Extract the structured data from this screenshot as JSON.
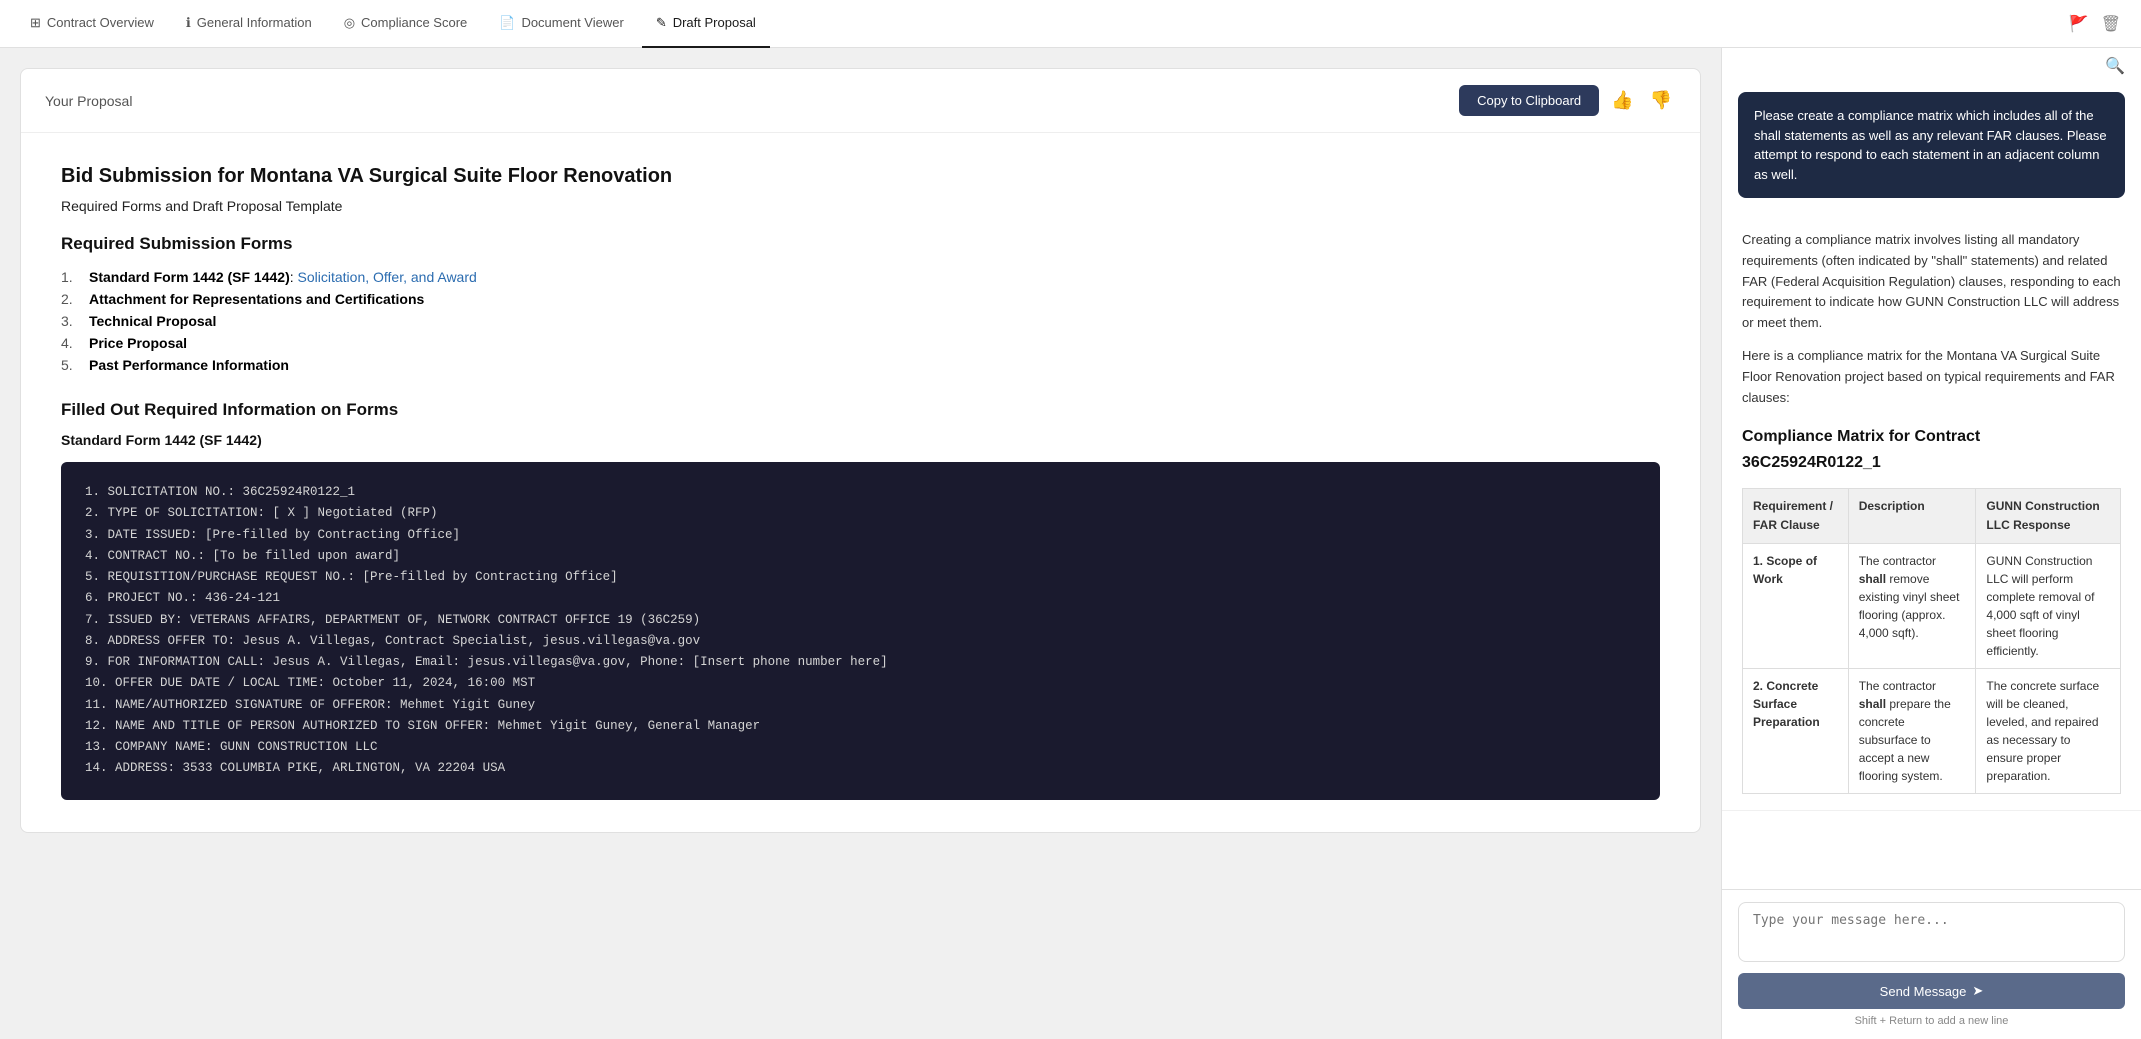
{
  "nav": {
    "tabs": [
      {
        "id": "contract-overview",
        "label": "Contract Overview",
        "icon": "⊞",
        "active": false
      },
      {
        "id": "general-information",
        "label": "General Information",
        "icon": "ℹ",
        "active": false
      },
      {
        "id": "compliance-score",
        "label": "Compliance Score",
        "icon": "◎",
        "active": false
      },
      {
        "id": "document-viewer",
        "label": "Document Viewer",
        "icon": "📄",
        "active": false
      },
      {
        "id": "draft-proposal",
        "label": "Draft Proposal",
        "icon": "✎",
        "active": true
      }
    ],
    "delete_icon": "🗑",
    "trash_icon": "🗑"
  },
  "proposal": {
    "label": "Your Proposal",
    "copy_button": "Copy to Clipboard",
    "title": "Bid Submission for Montana VA Surgical Suite Floor Renovation",
    "subtitle": "Required Forms and Draft Proposal Template",
    "required_submission_title": "Required Submission Forms",
    "forms_list": [
      {
        "num": "1.",
        "bold": "Standard Form 1442 (SF 1442)",
        "separator": ": ",
        "link": "Solicitation, Offer, and Award"
      },
      {
        "num": "2.",
        "bold": "Attachment for Representations and Certifications",
        "separator": "",
        "link": ""
      },
      {
        "num": "3.",
        "bold": "Technical Proposal",
        "separator": "",
        "link": ""
      },
      {
        "num": "4.",
        "bold": "Price Proposal",
        "separator": "",
        "link": ""
      },
      {
        "num": "5.",
        "bold": "Past Performance Information",
        "separator": "",
        "link": ""
      }
    ],
    "filled_section_title": "Filled Out Required Information on Forms",
    "sf1442_title": "Standard Form 1442 (SF 1442)",
    "code_lines": [
      "1.  SOLICITATION NO.: 36C25924R0122_1",
      "2.  TYPE OF SOLICITATION: [ X ] Negotiated (RFP)",
      "3.  DATE ISSUED: [Pre-filled by Contracting Office]",
      "4.  CONTRACT NO.: [To be filled upon award]",
      "5.  REQUISITION/PURCHASE REQUEST NO.: [Pre-filled by Contracting Office]",
      "6.  PROJECT NO.: 436-24-121",
      "7.  ISSUED BY: VETERANS AFFAIRS, DEPARTMENT OF, NETWORK CONTRACT OFFICE 19 (36C259)",
      "8.  ADDRESS OFFER TO: Jesus A. Villegas, Contract Specialist, jesus.villegas@va.gov",
      "9.  FOR INFORMATION CALL: Jesus A. Villegas, Email: jesus.villegas@va.gov, Phone: [Insert phone number here]",
      "10. OFFER DUE DATE / LOCAL TIME: October 11, 2024, 16:00 MST",
      "11. NAME/AUTHORIZED SIGNATURE OF OFFEROR: Mehmet Yigit Guney",
      "12. NAME AND TITLE OF PERSON AUTHORIZED TO SIGN OFFER: Mehmet Yigit Guney, General Manager",
      "13. COMPANY NAME: GUNN CONSTRUCTION LLC",
      "14. ADDRESS: 3533 COLUMBIA PIKE, ARLINGTON, VA 22204 USA"
    ]
  },
  "chat": {
    "tooltip": "Please create a compliance matrix which includes all of the shall statements as well as any relevant FAR clauses. Please attempt to respond to each statement in an adjacent column as well.",
    "ai_intro": "Creating a compliance matrix involves listing all mandatory requirements (often indicated by \"shall\" statements) and related FAR (Federal Acquisition Regulation) clauses, responding to each requirement to indicate how GUNN Construction LLC will address or meet them.",
    "ai_intro2": "Here is a compliance matrix for the Montana VA Surgical Suite Floor Renovation project based on typical requirements and FAR clauses:",
    "matrix_title": "Compliance Matrix for Contract 36C25924R0122_1",
    "table_headers": [
      "Requirement / FAR Clause",
      "Description",
      "GUNN Construction LLC Response"
    ],
    "table_rows": [
      {
        "requirement": "1. Scope of Work",
        "description": "The contractor shall remove existing vinyl sheet flooring (approx. 4,000 sqft).",
        "response": "GUNN Construction LLC will perform complete removal of 4,000 sqft of vinyl sheet flooring efficiently."
      },
      {
        "requirement": "2. Concrete Surface Preparation",
        "description": "The contractor shall prepare the concrete subsurface to accept a new flooring system.",
        "response": "The concrete surface will be cleaned, leveled, and repaired as necessary to ensure proper preparation."
      }
    ],
    "input_placeholder": "Type your message here...",
    "send_button": "Send Message",
    "hint": "Shift + Return to add a new line"
  }
}
